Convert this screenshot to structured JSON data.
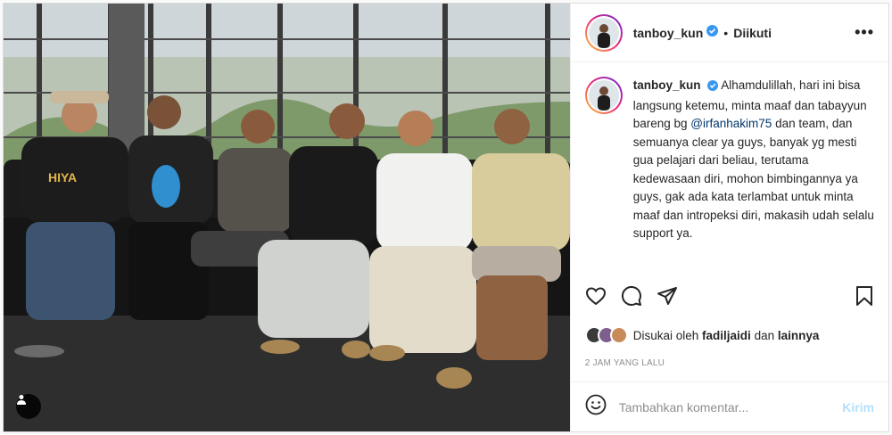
{
  "post": {
    "username": "tanboy_kun",
    "follow_status": "Diikuti",
    "more_label": "•••",
    "caption": {
      "username": "tanboy_kun",
      "text_before": "Alhamdulillah, hari ini bisa langsung ketemu, minta maaf dan tabayyun bareng bg",
      "mention": "@irfanhakim75",
      "text_after": "dan team, dan semuanya clear ya guys, banyak yg mesti gua pelajari dari beliau, terutama kedewasaan diri, mohon bimbingannya ya guys, gak ada kata terlambat untuk minta maaf dan intropeksi diri, makasih udah selalu support ya."
    },
    "likes": {
      "prefix": "Disukai oleh",
      "user": "fadiljaidi",
      "conjunction": "dan",
      "others": "lainnya"
    },
    "timestamp": "2 JAM YANG LALU",
    "comment": {
      "placeholder": "Tambahkan komentar...",
      "post_label": "Kirim"
    }
  },
  "icons": [
    "verified-icon",
    "heart-icon",
    "comment-icon",
    "share-icon",
    "bookmark-icon",
    "emoji-icon",
    "user-tag-icon"
  ],
  "colors": {
    "mention": "#00376b",
    "verified": "#3897f0",
    "post_button_disabled": "#b2dffc",
    "muted": "#8e8e8e"
  }
}
